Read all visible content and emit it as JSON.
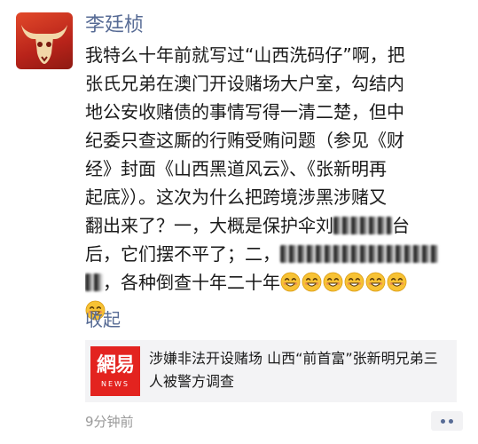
{
  "post": {
    "author": "李廷桢",
    "lines": [
      "我特么十年前就写过“山西洗码仔”啊，把",
      "张氏兄弟在澳门开设赌场大户室，勾结内",
      "地公安收赌债的事情写得一清二楚，但中",
      "纪委只查这厮的行贿受贿问题（参见《财",
      "经》封面《山西黑道风云》、《张新明再",
      "起底》）。这次为什么把跨境涉黑涉赌又"
    ],
    "line7_a": "翻出来了？一，大概是保护伞刘",
    "line7_b": "台",
    "line8_a": "后，它们摆不平了；二，",
    "line9_a": "，各种倒查十年二十年",
    "emoji_name": "grinning-face-emoji",
    "collapse_label": "收起",
    "link": {
      "thumb_logo": "網易",
      "thumb_sub": "NEWS",
      "title": "涉嫌非法开设赌场 山西“前首富”张新明兄弟三人被警方调查"
    },
    "time": "9分钟前"
  },
  "colors": {
    "name_blue": "#576b95",
    "netease_red": "#e3231f"
  }
}
